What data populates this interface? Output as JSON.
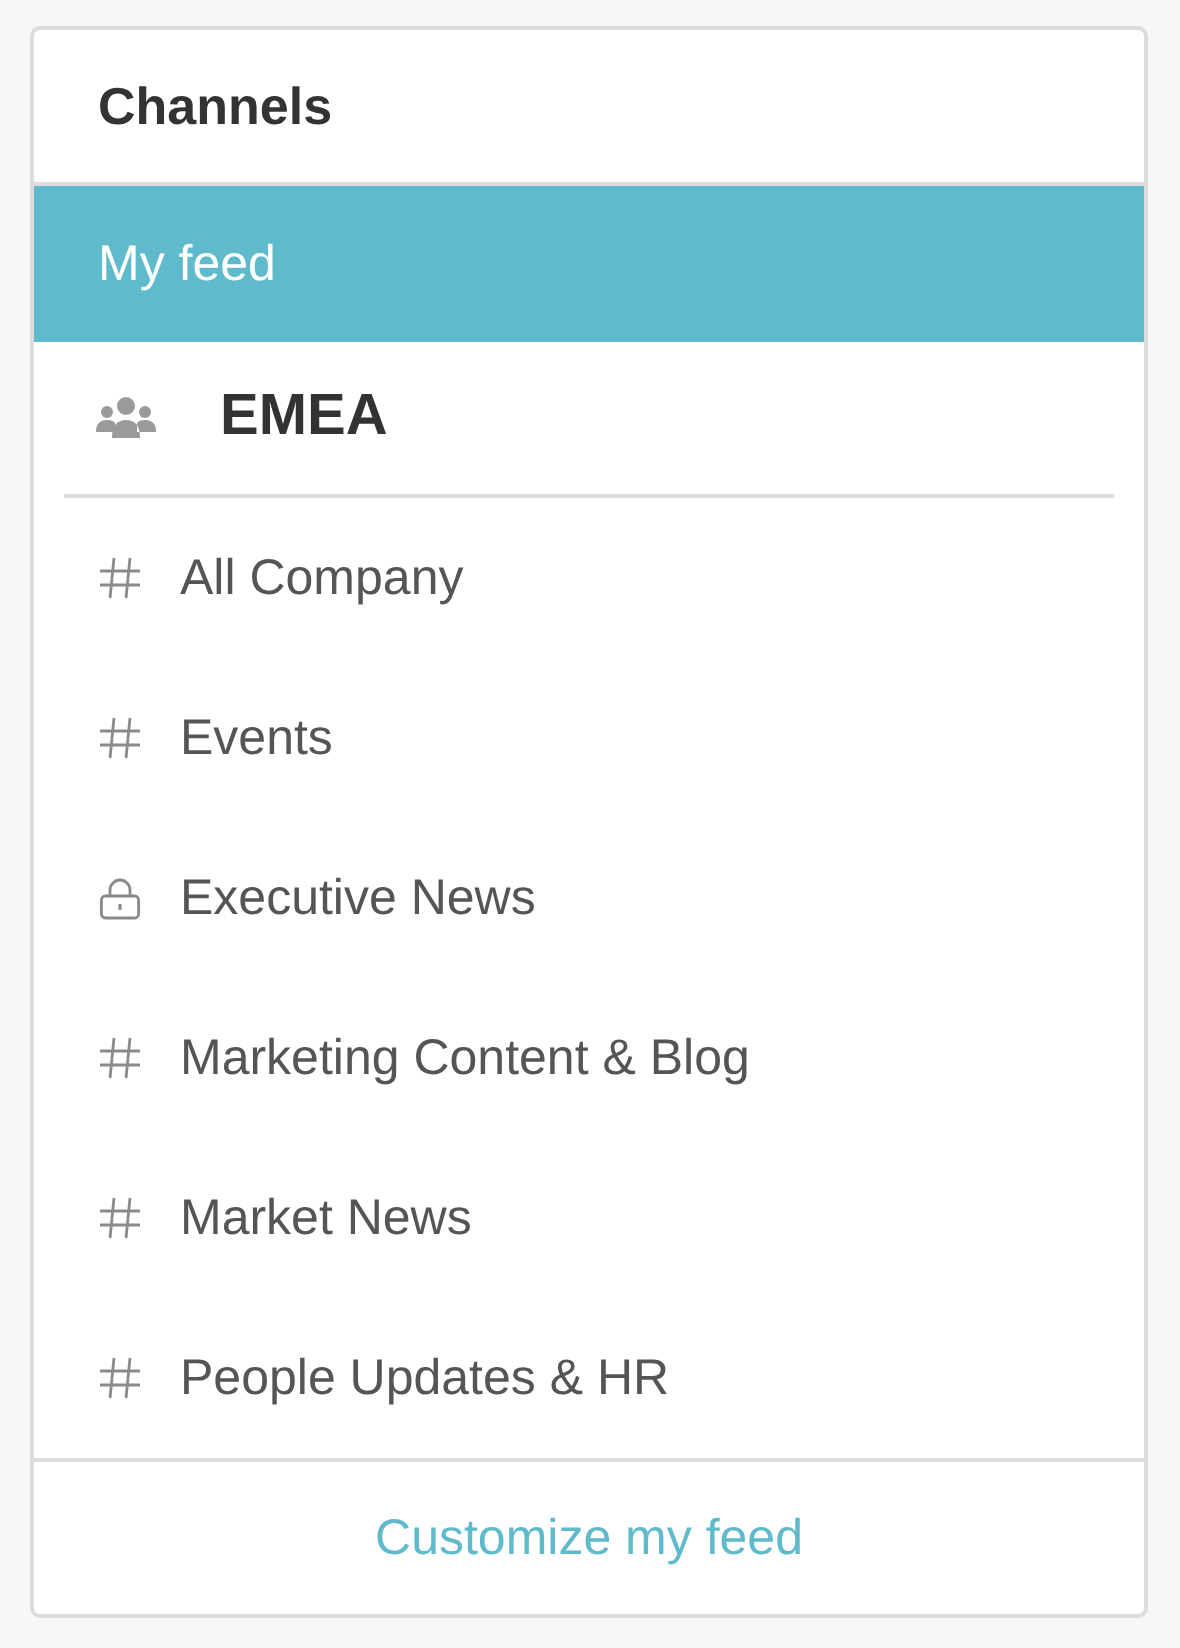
{
  "title": "Channels",
  "feed": {
    "label": "My feed",
    "selected": true
  },
  "group": {
    "label": "EMEA"
  },
  "channels": [
    {
      "name": "All Company",
      "kind": "public"
    },
    {
      "name": "Events",
      "kind": "public"
    },
    {
      "name": "Executive News",
      "kind": "private"
    },
    {
      "name": "Marketing Content & Blog",
      "kind": "public"
    },
    {
      "name": "Market News",
      "kind": "public"
    },
    {
      "name": "People Updates & HR",
      "kind": "public"
    }
  ],
  "footer_link": "Customize my feed"
}
